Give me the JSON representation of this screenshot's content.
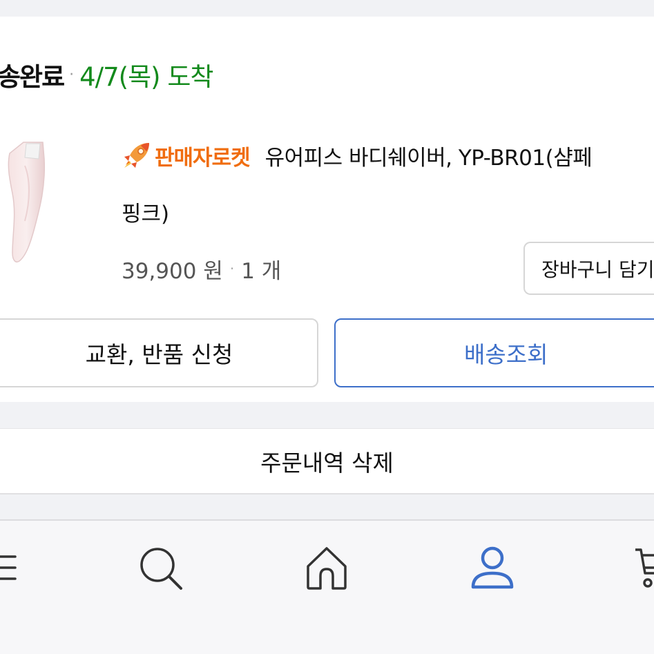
{
  "order": {
    "status": "송완료",
    "separator": "·",
    "arrival": "4/7(목) 도착",
    "status_color": "#138a1c"
  },
  "product": {
    "badge_icon": "rocket-icon",
    "badge_text": "판매자로켓",
    "name_line1": "유어피스 바디쉐이버, YP-BR01(샴페",
    "name_line2": "핑크)",
    "price": "39,900 원",
    "qty_separator": "·",
    "quantity": "1 개",
    "cart_button": "장바구니 담기"
  },
  "actions": {
    "return_label": "교환, 반품 신청",
    "track_label": "배송조회",
    "track_color": "#3d6fc9"
  },
  "delete_label": "주문내역 삭제",
  "tabbar": {
    "items": [
      {
        "icon": "menu-icon"
      },
      {
        "icon": "search-icon"
      },
      {
        "icon": "home-icon"
      },
      {
        "icon": "user-icon",
        "active": true
      },
      {
        "icon": "cart-icon"
      }
    ],
    "active_color": "#3d6fc9"
  }
}
